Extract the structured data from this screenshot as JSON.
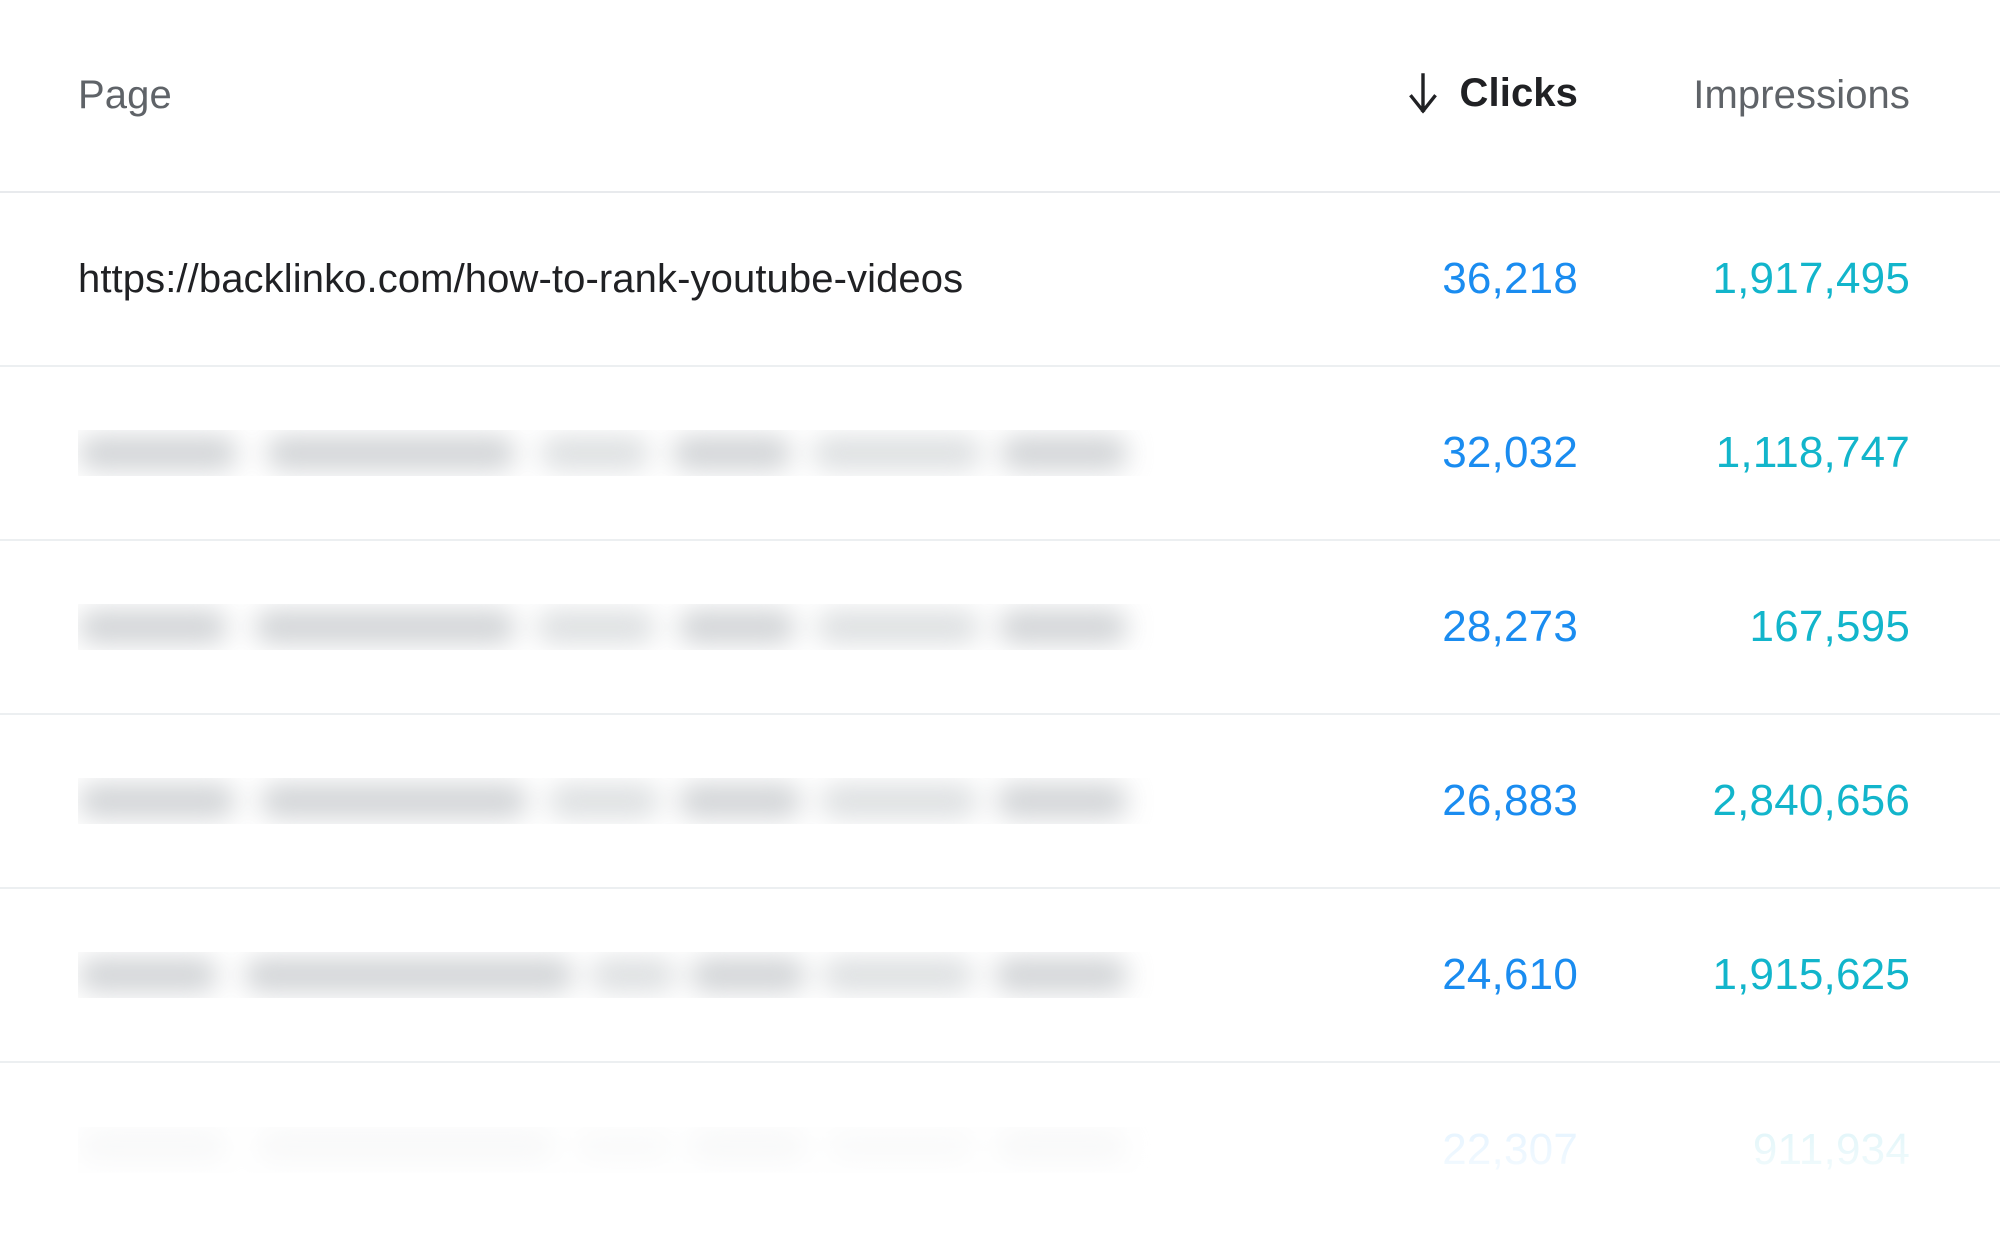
{
  "table": {
    "columns": {
      "page": "Page",
      "clicks": "Clicks",
      "impressions": "Impressions"
    },
    "sort": {
      "column": "Clicks",
      "direction": "descending",
      "icon": "arrow-down-icon"
    },
    "colors": {
      "clicks": "#1a8cf0",
      "impressions": "#12b5cb",
      "header_active": "#202124",
      "header_inactive": "#5f6368",
      "row_divider": "#eceff1"
    },
    "rows": [
      {
        "page": "https://backlinko.com/how-to-rank-youtube-videos",
        "page_redacted": false,
        "clicks": "36,218",
        "impressions": "1,917,495",
        "faded": false
      },
      {
        "page": "",
        "page_redacted": true,
        "clicks": "32,032",
        "impressions": "1,118,747",
        "faded": false
      },
      {
        "page": "",
        "page_redacted": true,
        "clicks": "28,273",
        "impressions": "167,595",
        "faded": false
      },
      {
        "page": "",
        "page_redacted": true,
        "clicks": "26,883",
        "impressions": "2,840,656",
        "faded": false
      },
      {
        "page": "",
        "page_redacted": true,
        "clicks": "24,610",
        "impressions": "1,915,625",
        "faded": false
      },
      {
        "page": "",
        "page_redacted": true,
        "clicks": "22,307",
        "impressions": "911,934",
        "faded": true
      }
    ]
  }
}
